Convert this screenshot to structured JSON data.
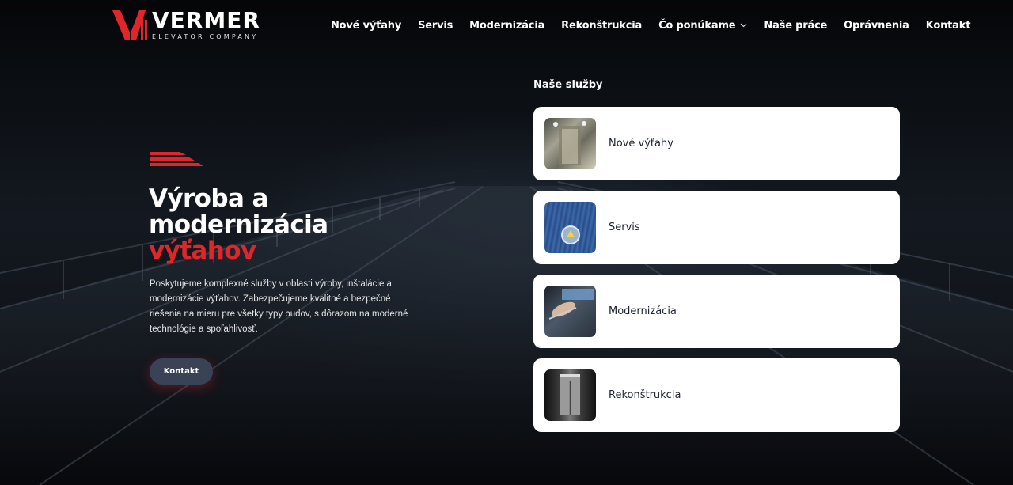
{
  "brand": {
    "name": "VERMER",
    "tagline": "ELEVATOR COMPANY",
    "accent": "#e0262b"
  },
  "nav": {
    "items": [
      "Nové výťahy",
      "Servis",
      "Modernizácia",
      "Rekonštrukcia",
      "Čo ponúkame",
      "Naše práce",
      "Oprávnenia",
      "Kontakt"
    ],
    "dropdown_icon": "chevron-down-icon"
  },
  "hero": {
    "title_line1": "Výroba a",
    "title_line2": "modernizácia",
    "title_accent": "výťahov",
    "description": "Poskytujeme komplexné služby v oblasti výroby, inštalácie a modernizácie výťahov. Zabezpečujeme kvalitné a bezpečné riešenia na mieru pre všetky typy budov, s dôrazom na moderné technológie a spoľahlivosť.",
    "cta_label": "Kontakt"
  },
  "services": {
    "title": "Naše služby",
    "items": [
      {
        "label": "Nové výťahy"
      },
      {
        "label": "Servis"
      },
      {
        "label": "Modernizácia"
      },
      {
        "label": "Rekonštrukcia"
      }
    ]
  }
}
